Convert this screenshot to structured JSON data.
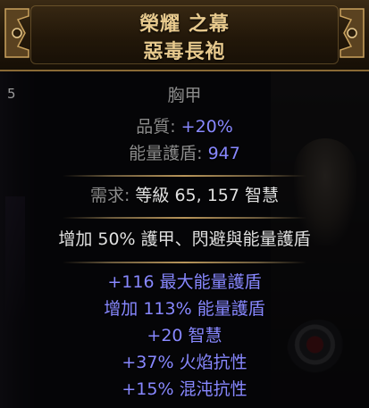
{
  "item": {
    "name": "榮耀 之幕",
    "base_type": "惡毒長袍",
    "item_class": "胸甲",
    "quality": {
      "label": "品質",
      "value": "+20%"
    },
    "energy_shield": {
      "label": "能量護盾",
      "value": "947"
    },
    "requirements": {
      "label": "需求",
      "value": "等級 65, 157 智慧"
    },
    "implicit": "增加 50% 護甲、閃避與能量護盾",
    "explicit_mods": [
      "+116 最大能量護盾",
      "增加 113% 能量護盾",
      "+20 智慧",
      "+37% 火焰抗性",
      "+15% 混沌抗性"
    ]
  },
  "side_badge": "5",
  "colors": {
    "title": "#e7c98d",
    "property_label": "#8b8b8b",
    "magic_value": "#8888ff",
    "implicit": "#e0e0e0"
  }
}
